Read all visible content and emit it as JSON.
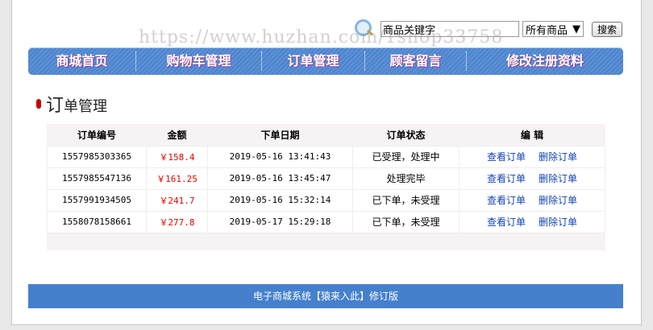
{
  "search": {
    "placeholder": "商品关键字",
    "value": "商品关键字",
    "category": "所有商品",
    "button": "搜索"
  },
  "nav": [
    "商城首页",
    "购物车管理",
    "订单管理",
    "顾客留言",
    "修改注册资料"
  ],
  "title_first": "订",
  "title_rest": "单管理",
  "table": {
    "headers": [
      "订单编号",
      "金额",
      "下单日期",
      "订单状态",
      "编 辑"
    ],
    "rows": [
      {
        "id": "1557985303365",
        "amount": "￥158.4",
        "date": "2019-05-16 13:41:43",
        "status": "已受理，处理中",
        "view": "查看订单",
        "delete": "删除订单"
      },
      {
        "id": "1557985547136",
        "amount": "￥161.25",
        "date": "2019-05-16 13:45:47",
        "status": "处理完毕",
        "view": "查看订单",
        "delete": "删除订单"
      },
      {
        "id": "1557991934505",
        "amount": "￥241.7",
        "date": "2019-05-16 15:32:14",
        "status": "已下单，未受理",
        "view": "查看订单",
        "delete": "删除订单"
      },
      {
        "id": "1558078158661",
        "amount": "￥277.8",
        "date": "2019-05-17 15:29:18",
        "status": "已下单，未受理",
        "view": "查看订单",
        "delete": "删除订单"
      }
    ]
  },
  "footer": "电子商城系统【猿来入此】修订版",
  "watermark": "https://www.huzhan.com/1shop33758"
}
